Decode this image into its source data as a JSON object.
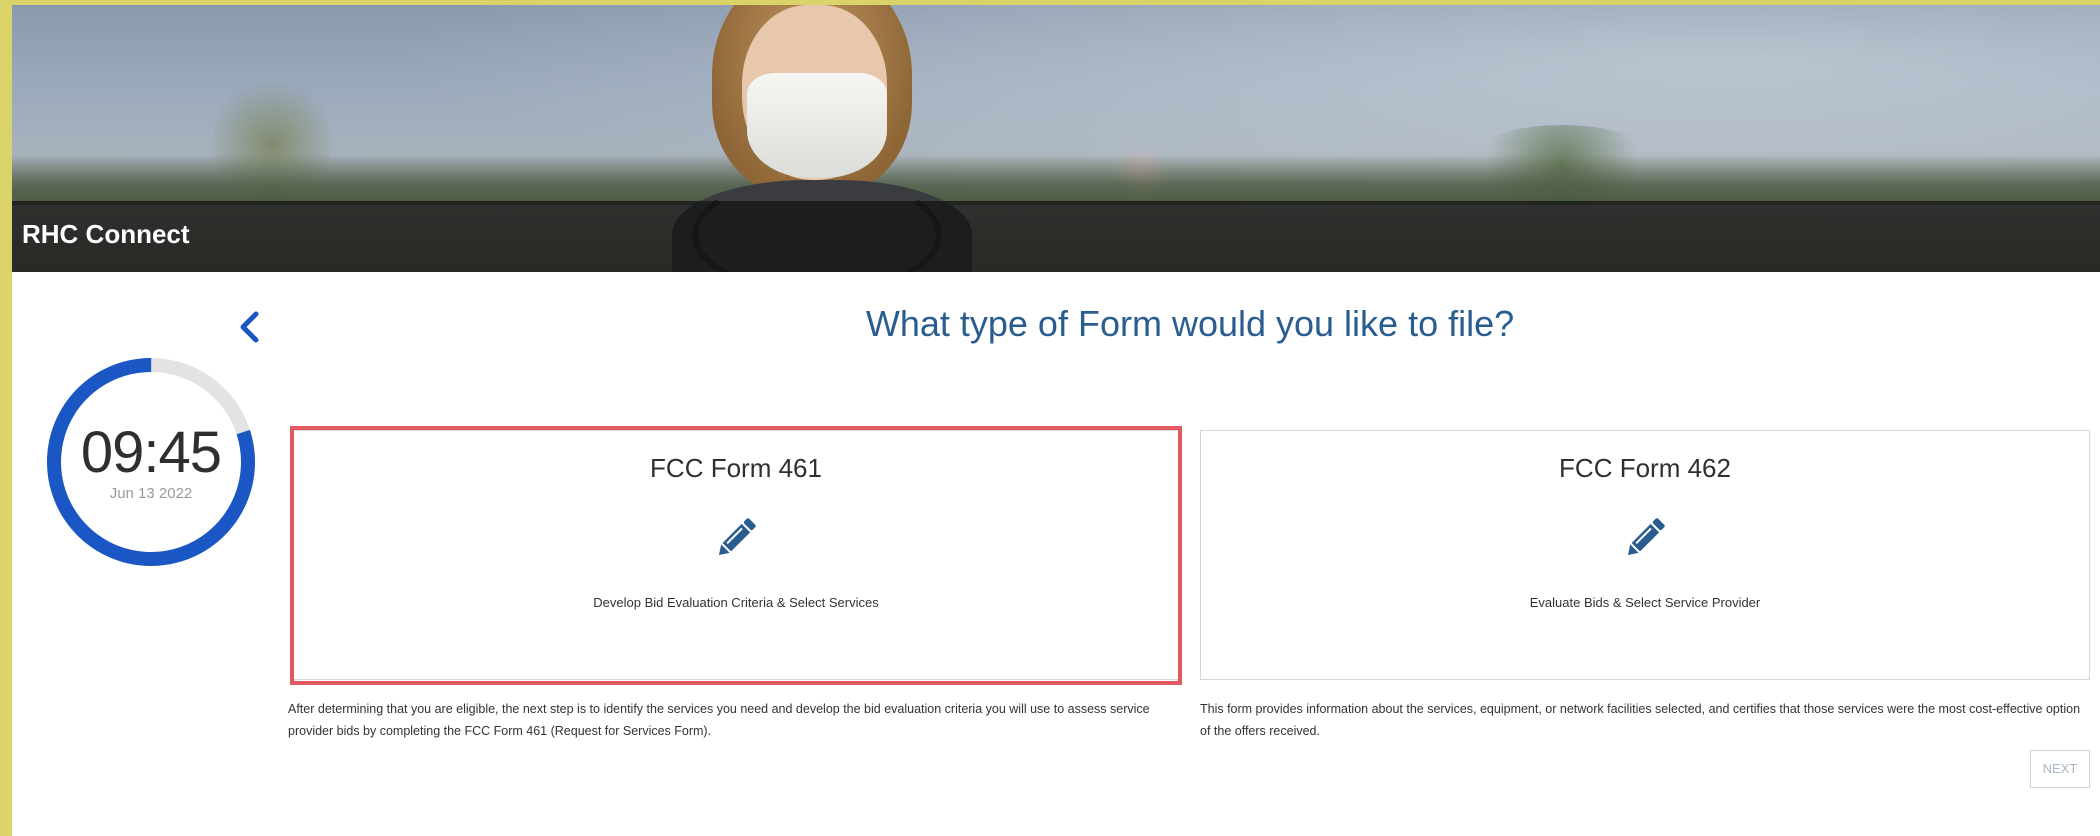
{
  "banner": {
    "title": "RHC Connect"
  },
  "timer": {
    "time": "09:45",
    "date": "Jun 13 2022",
    "progress_fraction": 0.8
  },
  "page": {
    "heading": "What type of Form would you like to file?"
  },
  "cards": [
    {
      "title": "FCC Form 461",
      "description": "Develop Bid Evaluation Criteria & Select Services",
      "note": "After determining that you are eligible, the next step is to identify the services you need and develop the bid evaluation criteria you will use to assess service provider bids by completing the FCC Form 461 (Request for Services Form).",
      "icon": "pencil-icon",
      "highlighted": true
    },
    {
      "title": "FCC Form 462",
      "description": "Evaluate Bids & Select Service Provider",
      "note": "This form provides information about the services, equipment, or network facilities selected, and certifies that those services were the most cost-effective option of the offers received.",
      "icon": "pencil-icon",
      "highlighted": false
    }
  ],
  "actions": {
    "next_label": "NEXT",
    "back_icon": "chevron-left-icon"
  },
  "colors": {
    "accent_blue": "#1a56c4",
    "heading_blue": "#2a5d8f",
    "highlight_red": "#e05a5f",
    "timer_track": "#e3e3e3"
  }
}
